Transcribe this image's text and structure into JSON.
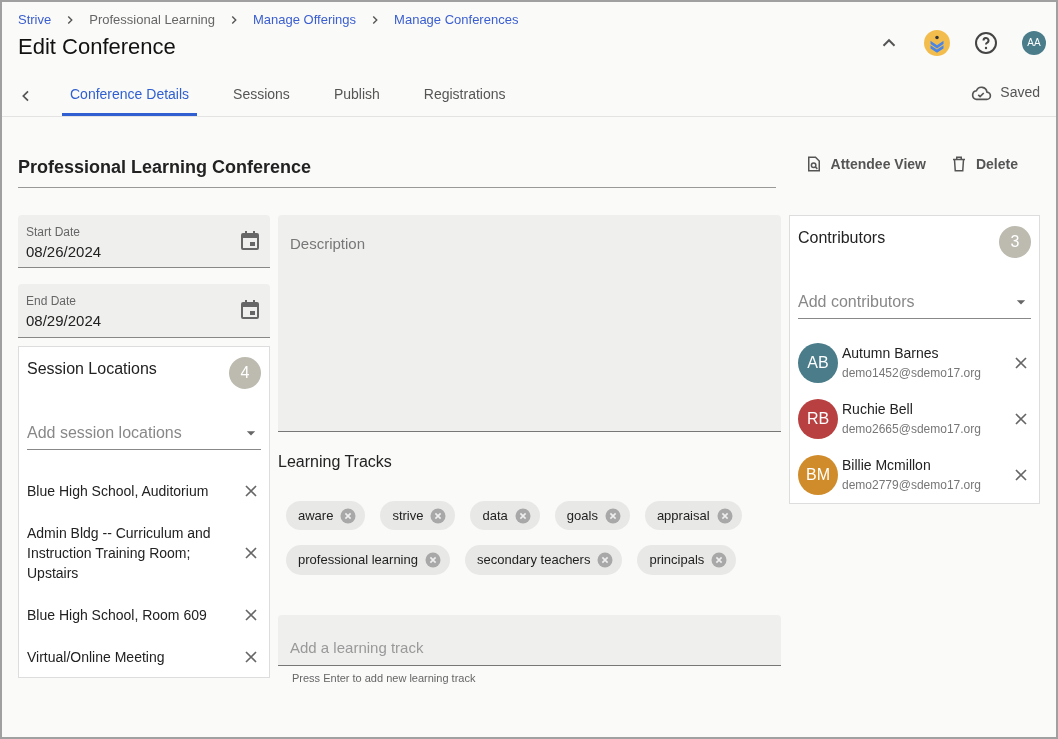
{
  "breadcrumbs": [
    {
      "label": "Strive",
      "link": true
    },
    {
      "label": "Professional Learning",
      "link": false
    },
    {
      "label": "Manage Offerings",
      "link": true
    },
    {
      "label": "Manage Conferences",
      "link": true
    }
  ],
  "page_title": "Edit Conference",
  "header_actions": {
    "avatar_initials": "AA"
  },
  "tabs": [
    {
      "label": "Conference Details",
      "selected": true
    },
    {
      "label": "Sessions",
      "selected": false
    },
    {
      "label": "Publish",
      "selected": false
    },
    {
      "label": "Registrations",
      "selected": false
    }
  ],
  "save_status": "Saved",
  "conference_name": "Professional Learning Conference",
  "actions": [
    "Attendee View",
    "Delete"
  ],
  "start_date": {
    "label": "Start Date",
    "value": "08/26/2024"
  },
  "end_date": {
    "label": "End Date",
    "value": "08/29/2024"
  },
  "session_locations": {
    "title": "Session Locations",
    "count": "4",
    "placeholder": "Add session locations",
    "items": [
      "Blue High School, Auditorium",
      "Admin Bldg -- Curriculum and Instruction Training Room; Upstairs",
      "Blue High School, Room 609",
      "Virtual/Online Meeting"
    ]
  },
  "description": {
    "placeholder": "Description"
  },
  "learning_tracks": {
    "title": "Learning Tracks",
    "chips": [
      "aware",
      "strive",
      "data",
      "goals",
      "appraisal",
      "professional learning",
      "secondary teachers",
      "principals"
    ],
    "placeholder": "Add a learning track",
    "hint": "Press Enter to add new learning track"
  },
  "contributors": {
    "title": "Contributors",
    "count": "3",
    "placeholder": "Add contributors",
    "people": [
      {
        "initials": "AB",
        "name": "Autumn Barnes",
        "email": "demo1452@sdemo17.org",
        "color": "#4a7c8a"
      },
      {
        "initials": "RB",
        "name": "Ruchie Bell",
        "email": "demo2665@sdemo17.org",
        "color": "#b94040"
      },
      {
        "initials": "BM",
        "name": "Billie Mcmillon",
        "email": "demo2779@sdemo17.org",
        "color": "#d08c2a"
      }
    ]
  }
}
